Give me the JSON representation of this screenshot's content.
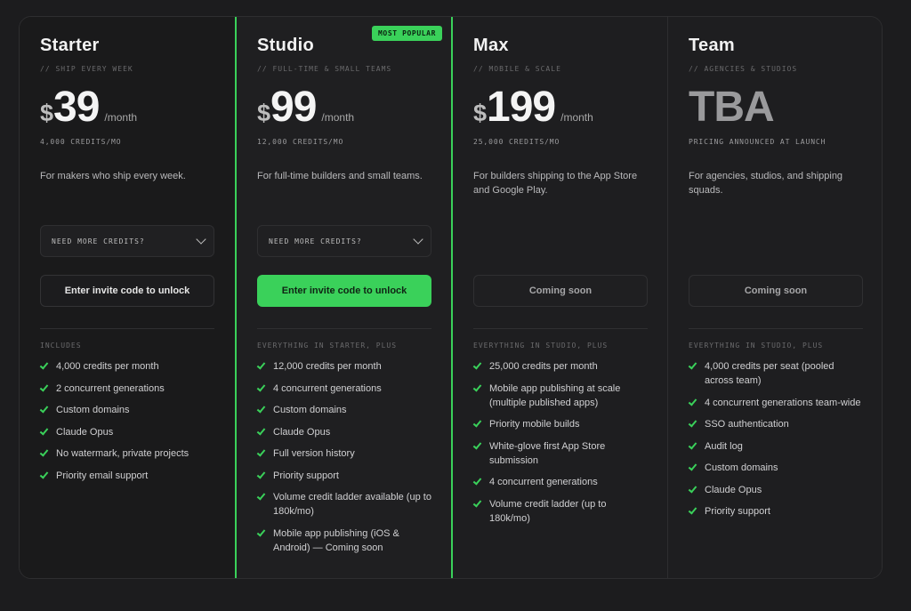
{
  "accent_color": "#3ad15a",
  "plans": [
    {
      "name": "Starter",
      "tag": "// SHIP EVERY WEEK",
      "currency": "$",
      "amount": "39",
      "per": "/month",
      "credits": "4,000 CREDITS/MO",
      "description": "For makers who ship every week.",
      "dropdown": "NEED MORE CREDITS?",
      "cta": "Enter invite code to unlock",
      "includes": "INCLUDES",
      "features": [
        "4,000 credits per month",
        "2 concurrent generations",
        "Custom domains",
        "Claude Opus",
        "No watermark, private projects",
        "Priority email support"
      ]
    },
    {
      "name": "Studio",
      "badge": "MOST POPULAR",
      "tag": "// FULL-TIME & SMALL TEAMS",
      "currency": "$",
      "amount": "99",
      "per": "/month",
      "credits": "12,000 CREDITS/MO",
      "description": "For full-time builders and small teams.",
      "dropdown": "NEED MORE CREDITS?",
      "cta": "Enter invite code to unlock",
      "includes": "EVERYTHING IN STARTER, PLUS",
      "features": [
        "12,000 credits per month",
        "4 concurrent generations",
        "Custom domains",
        "Claude Opus",
        "Full version history",
        "Priority support",
        "Volume credit ladder available (up to 180k/mo)",
        "Mobile app publishing (iOS & Android) — Coming soon"
      ]
    },
    {
      "name": "Max",
      "tag": "// MOBILE & SCALE",
      "currency": "$",
      "amount": "199",
      "per": "/month",
      "credits": "25,000 CREDITS/MO",
      "description": "For builders shipping to the App Store and Google Play.",
      "cta": "Coming soon",
      "includes": "EVERYTHING IN STUDIO, PLUS",
      "features": [
        "25,000 credits per month",
        "Mobile app publishing at scale (multiple published apps)",
        "Priority mobile builds",
        "White-glove first App Store submission",
        "4 concurrent generations",
        "Volume credit ladder (up to 180k/mo)"
      ]
    },
    {
      "name": "Team",
      "tag": "// AGENCIES & STUDIOS",
      "price_text": "TBA",
      "credits": "PRICING ANNOUNCED AT LAUNCH",
      "description": "For agencies, studios, and shipping squads.",
      "cta": "Coming soon",
      "includes": "EVERYTHING IN STUDIO, PLUS",
      "features": [
        "4,000 credits per seat (pooled across team)",
        "4 concurrent generations team-wide",
        "SSO authentication",
        "Audit log",
        "Custom domains",
        "Claude Opus",
        "Priority support"
      ]
    }
  ]
}
